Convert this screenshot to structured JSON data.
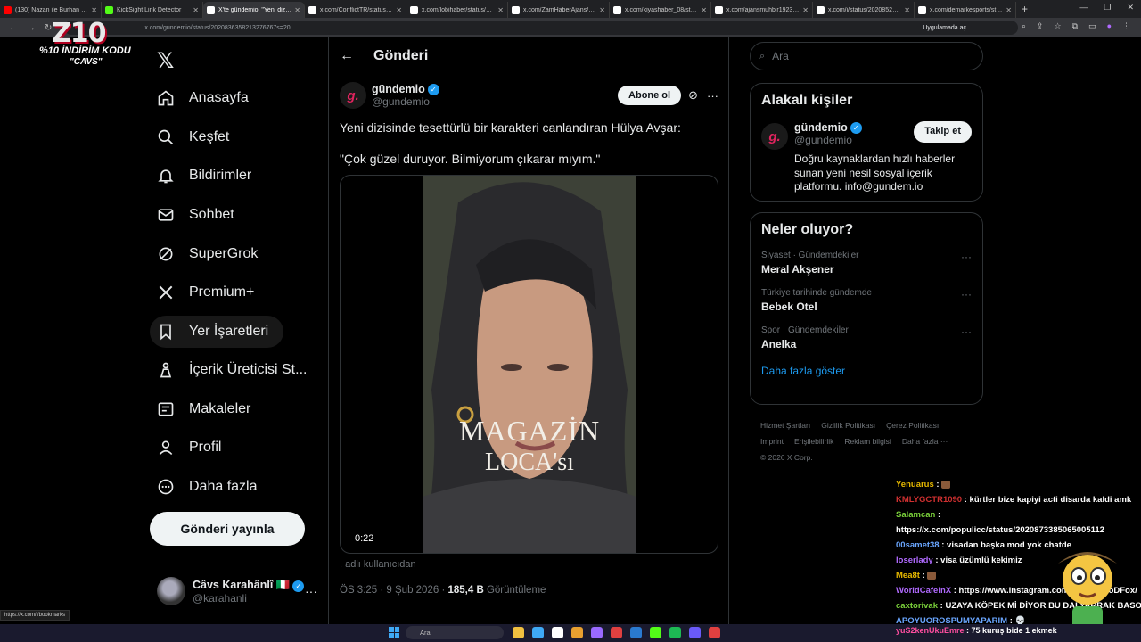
{
  "browser": {
    "tabs": [
      {
        "title": "(130) Nazan ile Burhan canlı y",
        "color": "#ff0000",
        "active": false
      },
      {
        "title": "KickSight Link Detector",
        "color": "#53fc18",
        "active": false
      },
      {
        "title": "X'te gündemio: \"Yeni dizisind",
        "color": "#ffffff",
        "active": true
      },
      {
        "title": "x.com/ConflictTR/status/2020",
        "color": "#ffffff",
        "active": false
      },
      {
        "title": "x.com/lobihaber/status/2020",
        "color": "#ffffff",
        "active": false
      },
      {
        "title": "x.com/ZamHaberAjans/statu",
        "color": "#ffffff",
        "active": false
      },
      {
        "title": "x.com/kiyashaber_08/status/2",
        "color": "#ffffff",
        "active": false
      },
      {
        "title": "x.com/ajansmuhbir1923/statu",
        "color": "#ffffff",
        "active": false
      },
      {
        "title": "x.com/i/status/20208529368",
        "color": "#ffffff",
        "active": false
      },
      {
        "title": "x.com/demarkesports/status/",
        "color": "#ffffff",
        "active": false
      }
    ],
    "url": "x.com/gundemio/status/2020836358213276767s=20",
    "open_in_app": "Uygulamada aç",
    "status_url": "https://x.com/i/bookmarks"
  },
  "stream_logo": {
    "letters": "Z10",
    "promo": "%10 İNDİRİM KODU",
    "code": "\"CAVS\""
  },
  "nav": {
    "items": [
      {
        "label": "Anasayfa",
        "icon": "home-icon"
      },
      {
        "label": "Keşfet",
        "icon": "search-icon"
      },
      {
        "label": "Bildirimler",
        "icon": "bell-icon"
      },
      {
        "label": "Sohbet",
        "icon": "mail-icon"
      },
      {
        "label": "SuperGrok",
        "icon": "grok-icon"
      },
      {
        "label": "Premium+",
        "icon": "x-icon"
      },
      {
        "label": "Yer İşaretleri",
        "icon": "bookmark-icon"
      },
      {
        "label": "İçerik Üreticisi St...",
        "icon": "creator-icon"
      },
      {
        "label": "Makaleler",
        "icon": "article-icon"
      },
      {
        "label": "Profil",
        "icon": "profile-icon"
      },
      {
        "label": "Daha fazla",
        "icon": "more-circle-icon"
      }
    ],
    "post_button": "Gönderi yayınla",
    "account": {
      "name": "Câvs Karahânlî 🇮🇹",
      "handle": "@karahanli"
    }
  },
  "post": {
    "header_title": "Gönderi",
    "author_name": "gündemio",
    "author_handle": "@gundemio",
    "subscribe_label": "Abone ol",
    "text": "Yeni dizisinde tesettürlü bir karakteri canlandıran Hülya Avşar:",
    "quote": "\"Çok güzel duruyor. Bilmiyorum çıkarar mıyım.\"",
    "video_overlay_line1": "MAGAZİN",
    "video_overlay_line2": "LOCA'sı",
    "video_time": "0:22",
    "alt_note": ". adlı kullanıcıdan",
    "time": "ÖS 3:25 · 9 Şub 2026 · ",
    "views": "185,4 B",
    "views_label": " Görüntüleme"
  },
  "right": {
    "search_placeholder": "Ara",
    "related_title": "Alakalı kişiler",
    "related_user": {
      "name": "gündemio",
      "handle": "@gundemio",
      "follow_label": "Takip et",
      "bio": "Doğru kaynaklardan hızlı haberler sunan yeni nesil sosyal içerik platformu. info@gundem.io"
    },
    "trends_title": "Neler oluyor?",
    "trends": [
      {
        "meta": "Siyaset · Gündemdekiler",
        "name": "Meral Akşener"
      },
      {
        "meta": "Türkiye tarihinde gündemde",
        "name": "Bebek Otel"
      },
      {
        "meta": "Spor · Gündemdekiler",
        "name": "Anelka"
      }
    ],
    "show_more": "Daha fazla göster",
    "footer_links": [
      "Hizmet Şartları",
      "Gizlilik Politikası",
      "Çerez Politikası",
      "Imprint",
      "Erişilebilirlik",
      "Reklam bilgisi",
      "Daha fazla ···",
      "© 2026 X Corp."
    ]
  },
  "chat": [
    {
      "nick": "Yenuarus",
      "color": "nick-y",
      "text": " : ",
      "emote": true
    },
    {
      "nick": "KMLYGCTR1090",
      "color": "nick-r",
      "text": " : kürtler bize kapiyi acti disarda kaldi amk"
    },
    {
      "nick": "Salamcan",
      "color": "nick-g",
      "text": " :"
    },
    {
      "nick": "",
      "color": "nick-g",
      "text": "https://x.com/populicc/status/2020873385065005112"
    },
    {
      "nick": "00samet38",
      "color": "nick-b",
      "text": " : visadan başka mod yok chatde"
    },
    {
      "nick": "loserlady",
      "color": "nick-p",
      "text": " : visa üzümlü kekimiz"
    },
    {
      "nick": "Mea8t",
      "color": "nick-y",
      "text": " : ",
      "emote": true
    },
    {
      "nick": "WorldCafeinX",
      "color": "nick-p",
      "text": " : https://www.instagram.com/p/DUa-ZvoDFox/"
    },
    {
      "nick": "caxtorivak",
      "color": "nick-g",
      "text": " : UZAYA KÖPEK Mİ DİYOR BU DALYARRAK BASOT"
    },
    {
      "nick": "APOYUOROSPUMYAPARIM",
      "color": "nick-b",
      "text": " : 💀"
    }
  ],
  "taskbar": {
    "search": "Ara",
    "last_chat_nick": "yuS2kenUkuEmre",
    "last_chat_text": " : 75 kuruş bide 1 ekmek"
  }
}
